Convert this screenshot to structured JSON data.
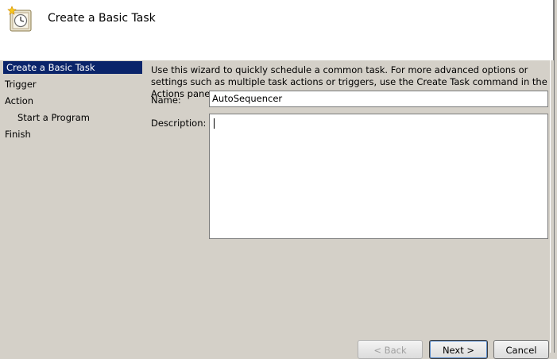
{
  "wizard": {
    "title": "Create a Basic Task"
  },
  "steps": [
    {
      "label": "Create a Basic Task",
      "active": true
    },
    {
      "label": "Trigger"
    },
    {
      "label": "Action"
    },
    {
      "label": "Start a Program",
      "sub": true
    },
    {
      "label": "Finish"
    }
  ],
  "main": {
    "description": "Use this wizard to quickly schedule a common task.  For more advanced options or settings such as multiple task actions or triggers, use the Create Task command in the Actions pane.",
    "name_label": "Name:",
    "name_value": "AutoSequencer",
    "description_label": "Description:",
    "description_value": ""
  },
  "buttons": {
    "back": "< Back",
    "next": "Next >",
    "cancel": "Cancel"
  },
  "colors": {
    "selection": "#0a246a",
    "panel": "#d4d0c8"
  },
  "icons": [
    "task-scheduler-icon"
  ]
}
